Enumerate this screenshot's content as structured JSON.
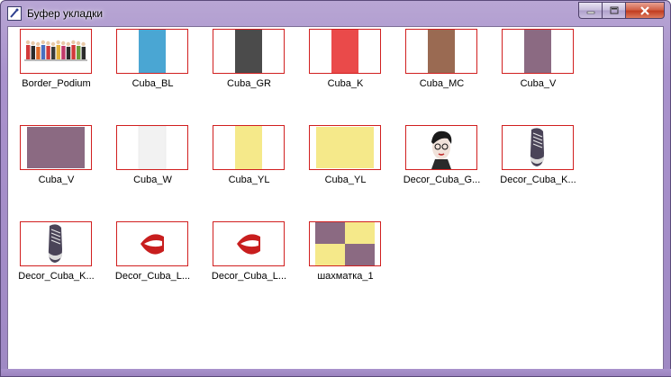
{
  "window": {
    "title": "Буфер укладки",
    "icon": "app-window-icon",
    "buttons": [
      {
        "name": "minimize-button",
        "icon": "minimize-icon"
      },
      {
        "name": "maximize-button",
        "icon": "maximize-icon"
      },
      {
        "name": "close-button",
        "icon": "close-icon"
      }
    ]
  },
  "colors": {
    "thumb_border": "#d11f1f",
    "frame": "#a992cc",
    "close": "#c13d21"
  },
  "tiles": [
    {
      "label": "Border_Podium",
      "preview": "podium-figures"
    },
    {
      "label": "Cuba_BL",
      "preview": "strip",
      "color": "#4aa6d3"
    },
    {
      "label": "Cuba_GR",
      "preview": "strip",
      "color": "#4b4b4b"
    },
    {
      "label": "Cuba_K",
      "preview": "strip",
      "color": "#ea4a4a"
    },
    {
      "label": "Cuba_MC",
      "preview": "strip",
      "color": "#9a6a52"
    },
    {
      "label": "Cuba_V",
      "preview": "strip",
      "color": "#8b6a82"
    },
    {
      "label": "Cuba_V",
      "preview": "square",
      "color": "#8b6a82"
    },
    {
      "label": "Cuba_W",
      "preview": "strip",
      "color": "#f2f2f2"
    },
    {
      "label": "Cuba_YL",
      "preview": "strip",
      "color": "#f5e98a"
    },
    {
      "label": "Cuba_YL",
      "preview": "square",
      "color": "#f5e98a"
    },
    {
      "label": "Decor_Cuba_G...",
      "preview": "face"
    },
    {
      "label": "Decor_Cuba_K...",
      "preview": "sneaker"
    },
    {
      "label": "Decor_Cuba_K...",
      "preview": "sneaker"
    },
    {
      "label": "Decor_Cuba_L...",
      "preview": "lips"
    },
    {
      "label": "Decor_Cuba_L...",
      "preview": "lips"
    },
    {
      "label": "шахматка_1",
      "preview": "checker",
      "color": "#8b6a82",
      "color2": "#f5e98a"
    }
  ]
}
